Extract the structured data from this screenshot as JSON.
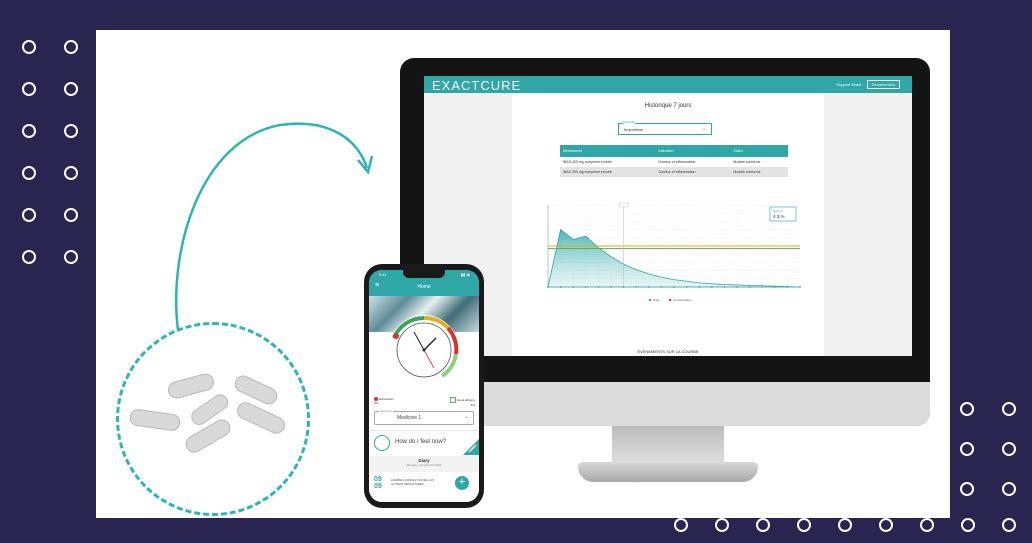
{
  "colors": {
    "accent": "#2ea7a6",
    "background": "#2a2450",
    "danger": "#d9322b"
  },
  "dashboard": {
    "logo": "EXACTCURE",
    "nav_link": "Support Exact",
    "nav_button": "Déconnexion",
    "title": "Historique 7 jours",
    "select_label": "Molécule",
    "select_value": "Ibuprofène",
    "table": {
      "headers": [
        "Médicament",
        "Indication",
        "Statut"
      ],
      "rows": [
        [
          "IBAS 400 mg comprimé enrobé",
          "Douleur et inflammation",
          "Modèle conforme"
        ],
        [
          "IBAS 200 mg comprimé enrobé",
          "Douleur et inflammation",
          "Modèle conforme"
        ]
      ]
    },
    "chart_badge_label": "Seuil 1",
    "chart_badge_value": "4.3 %",
    "events_label": "ÉVÉNEMENTS SUR LA COURBE",
    "legend": [
      "Prise",
      "Concentration"
    ]
  },
  "chart_data": {
    "type": "area",
    "x": [
      0,
      1,
      2,
      3,
      4,
      5,
      6,
      7,
      8,
      9,
      10,
      11,
      12,
      13,
      14,
      15,
      16,
      17,
      18,
      19,
      20
    ],
    "series": [
      {
        "values": [
          0,
          70,
          58,
          62,
          48,
          37,
          28,
          21,
          16,
          12,
          9,
          7,
          5,
          4,
          3,
          2.5,
          2,
          1.5,
          1,
          0.5,
          0
        ]
      }
    ],
    "threshold_lines": [
      {
        "value": 50,
        "color": "orange"
      },
      {
        "value": 47,
        "color": "green"
      }
    ],
    "ylim": [
      0,
      100
    ],
    "grid": true
  },
  "phone": {
    "time": "9:41",
    "status": "▮▮ ◉",
    "title": "Home",
    "legend_left": [
      "Exhaustion",
      "5%"
    ],
    "legend_right": [
      "Good efficacy",
      "5%"
    ],
    "select_label": "Medicine",
    "select_value": "Medicine 1",
    "feel_text": "How do I feel now?",
    "diary_title": "Diary",
    "diary_date": "Monday, January 09 2023",
    "entry_date_day": "09",
    "entry_date_month": "09",
    "entry_text": "LAMPADA CONSULT 40 DEL LAS ULTIMAS DIFICULTADES",
    "fab": "+"
  }
}
